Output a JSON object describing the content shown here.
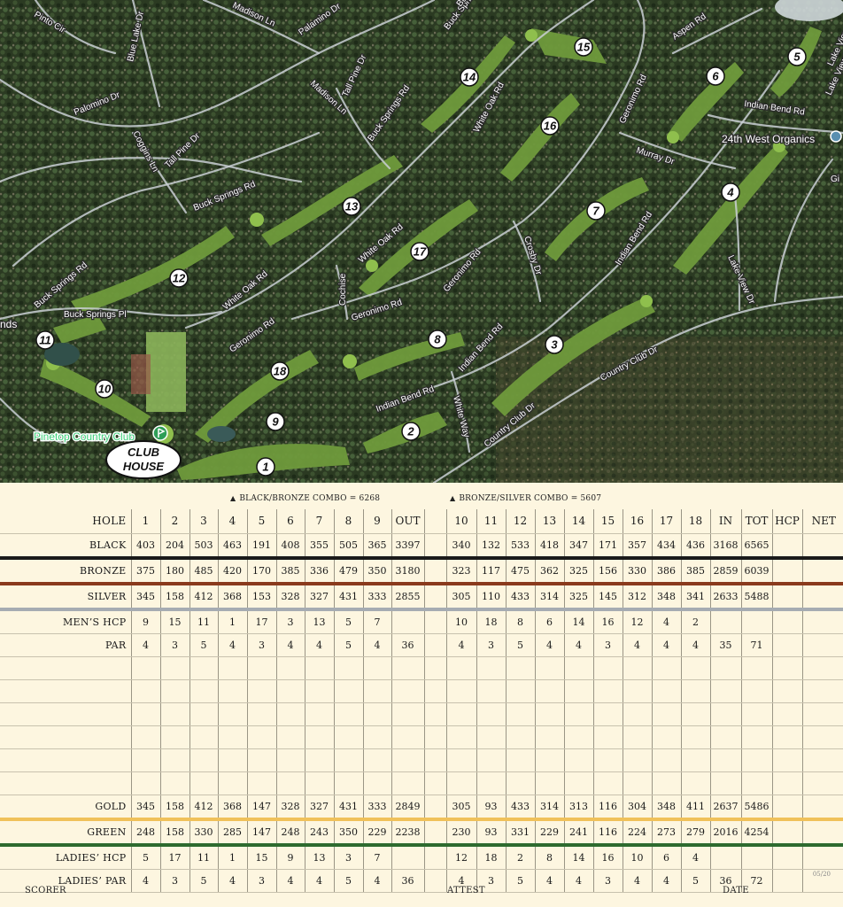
{
  "map": {
    "streets": [
      {
        "name": "Pinto Cir"
      },
      {
        "name": "Madison Ln"
      },
      {
        "name": "Palamino Dr"
      },
      {
        "name": "Buck Springs Rd"
      },
      {
        "name": "Madison Ln"
      },
      {
        "name": "Tall Pine Dr"
      },
      {
        "name": "Blue Lake Dr"
      },
      {
        "name": "Palomino Dr"
      },
      {
        "name": "Buck Springs Rd"
      },
      {
        "name": "Coggins Ln"
      },
      {
        "name": "Tall Pine Dr"
      },
      {
        "name": "Buck Springs Rd"
      },
      {
        "name": "White Oak Rd"
      },
      {
        "name": "Geronimo Rd"
      },
      {
        "name": "Aspen Rd"
      },
      {
        "name": "Indian Bend Rd"
      },
      {
        "name": "Murray Dr"
      },
      {
        "name": "Lake View Dr"
      },
      {
        "name": "White Oak Rd"
      },
      {
        "name": "Buck Springs Rd"
      },
      {
        "name": "Buck Springs Pl"
      },
      {
        "name": "White Oak Rd"
      },
      {
        "name": "Cochise"
      },
      {
        "name": "Geronimo Rd"
      },
      {
        "name": "Geronimo Rd"
      },
      {
        "name": "Crosby Dr"
      },
      {
        "name": "Indian Bend Rd"
      },
      {
        "name": "Lake View Dr"
      },
      {
        "name": "Geronimo Rd"
      },
      {
        "name": "Indian Bend Rd"
      },
      {
        "name": "Indian Bend Rd"
      },
      {
        "name": "White Way"
      },
      {
        "name": "Country Club Dr"
      },
      {
        "name": "Country Club Dr"
      },
      {
        "name": "Buck Spr"
      },
      {
        "name": "Lake View"
      },
      {
        "name": "nds"
      },
      {
        "name": "Gi"
      }
    ],
    "holes": [
      "1",
      "2",
      "3",
      "4",
      "5",
      "6",
      "7",
      "8",
      "9",
      "10",
      "11",
      "12",
      "13",
      "14",
      "15",
      "16",
      "17",
      "18"
    ],
    "poi": {
      "organics": "24th West Organics",
      "club": "Pinetop Country Club"
    },
    "clubhouse": [
      "CLUB",
      "HOUSE"
    ]
  },
  "scorecard": {
    "combo_black_bronze": "BLACK/BRONZE COMBO = 6268",
    "combo_bronze_silver": "BRONZE/SILVER COMBO = 5607",
    "rows": [
      {
        "label": "HOLE",
        "cells": [
          "1",
          "2",
          "3",
          "4",
          "5",
          "6",
          "7",
          "8",
          "9",
          "OUT",
          "10",
          "11",
          "12",
          "13",
          "14",
          "15",
          "16",
          "17",
          "18",
          "IN",
          "TOT",
          "HCP",
          "NET"
        ]
      },
      {
        "label": "BLACK",
        "cells": [
          "403",
          "204",
          "503",
          "463",
          "191",
          "408",
          "355",
          "505",
          "365",
          "3397",
          "340",
          "132",
          "533",
          "418",
          "347",
          "171",
          "357",
          "434",
          "436",
          "3168",
          "6565",
          "",
          ""
        ]
      },
      {
        "label": "BRONZE",
        "cells": [
          "375",
          "180",
          "485",
          "420",
          "170",
          "385",
          "336",
          "479",
          "350",
          "3180",
          "323",
          "117",
          "475",
          "362",
          "325",
          "156",
          "330",
          "386",
          "385",
          "2859",
          "6039",
          "",
          ""
        ]
      },
      {
        "label": "SILVER",
        "cells": [
          "345",
          "158",
          "412",
          "368",
          "153",
          "328",
          "327",
          "431",
          "333",
          "2855",
          "305",
          "110",
          "433",
          "314",
          "325",
          "145",
          "312",
          "348",
          "341",
          "2633",
          "5488",
          "",
          ""
        ]
      },
      {
        "label": "MEN’S HCP",
        "cells": [
          "9",
          "15",
          "11",
          "1",
          "17",
          "3",
          "13",
          "5",
          "7",
          "",
          "10",
          "18",
          "8",
          "6",
          "14",
          "16",
          "12",
          "4",
          "2",
          "",
          "",
          "",
          ""
        ]
      },
      {
        "label": "PAR",
        "cells": [
          "4",
          "3",
          "5",
          "4",
          "3",
          "4",
          "4",
          "5",
          "4",
          "36",
          "4",
          "3",
          "5",
          "4",
          "4",
          "3",
          "4",
          "4",
          "4",
          "35",
          "71",
          "",
          ""
        ]
      },
      {
        "label": "",
        "cells": [
          "",
          "",
          "",
          "",
          "",
          "",
          "",
          "",
          "",
          "",
          "",
          "",
          "",
          "",
          "",
          "",
          "",
          "",
          "",
          "",
          "",
          "",
          ""
        ]
      },
      {
        "label": "",
        "cells": [
          "",
          "",
          "",
          "",
          "",
          "",
          "",
          "",
          "",
          "",
          "",
          "",
          "",
          "",
          "",
          "",
          "",
          "",
          "",
          "",
          "",
          "",
          ""
        ]
      },
      {
        "label": "",
        "cells": [
          "",
          "",
          "",
          "",
          "",
          "",
          "",
          "",
          "",
          "",
          "",
          "",
          "",
          "",
          "",
          "",
          "",
          "",
          "",
          "",
          "",
          "",
          ""
        ]
      },
      {
        "label": "",
        "cells": [
          "",
          "",
          "",
          "",
          "",
          "",
          "",
          "",
          "",
          "",
          "",
          "",
          "",
          "",
          "",
          "",
          "",
          "",
          "",
          "",
          "",
          "",
          ""
        ]
      },
      {
        "label": "",
        "cells": [
          "",
          "",
          "",
          "",
          "",
          "",
          "",
          "",
          "",
          "",
          "",
          "",
          "",
          "",
          "",
          "",
          "",
          "",
          "",
          "",
          "",
          "",
          ""
        ]
      },
      {
        "label": "",
        "cells": [
          "",
          "",
          "",
          "",
          "",
          "",
          "",
          "",
          "",
          "",
          "",
          "",
          "",
          "",
          "",
          "",
          "",
          "",
          "",
          "",
          "",
          "",
          ""
        ]
      },
      {
        "label": "GOLD",
        "cells": [
          "345",
          "158",
          "412",
          "368",
          "147",
          "328",
          "327",
          "431",
          "333",
          "2849",
          "305",
          "93",
          "433",
          "314",
          "313",
          "116",
          "304",
          "348",
          "411",
          "2637",
          "5486",
          "",
          ""
        ]
      },
      {
        "label": "GREEN",
        "cells": [
          "248",
          "158",
          "330",
          "285",
          "147",
          "248",
          "243",
          "350",
          "229",
          "2238",
          "230",
          "93",
          "331",
          "229",
          "241",
          "116",
          "224",
          "273",
          "279",
          "2016",
          "4254",
          "",
          ""
        ]
      },
      {
        "label": "LADIES’ HCP",
        "cells": [
          "5",
          "17",
          "11",
          "1",
          "15",
          "9",
          "13",
          "3",
          "7",
          "",
          "12",
          "18",
          "2",
          "8",
          "14",
          "16",
          "10",
          "6",
          "4",
          "",
          "",
          "",
          ""
        ]
      },
      {
        "label": "LADIES’ PAR",
        "cells": [
          "4",
          "3",
          "5",
          "4",
          "3",
          "4",
          "4",
          "5",
          "4",
          "36",
          "4",
          "3",
          "5",
          "4",
          "4",
          "3",
          "4",
          "4",
          "5",
          "36",
          "72",
          "",
          ""
        ]
      }
    ],
    "footer": {
      "scorer": "SCORER",
      "attest": "ATTEST",
      "date": "DATE"
    },
    "version": "05/20"
  }
}
